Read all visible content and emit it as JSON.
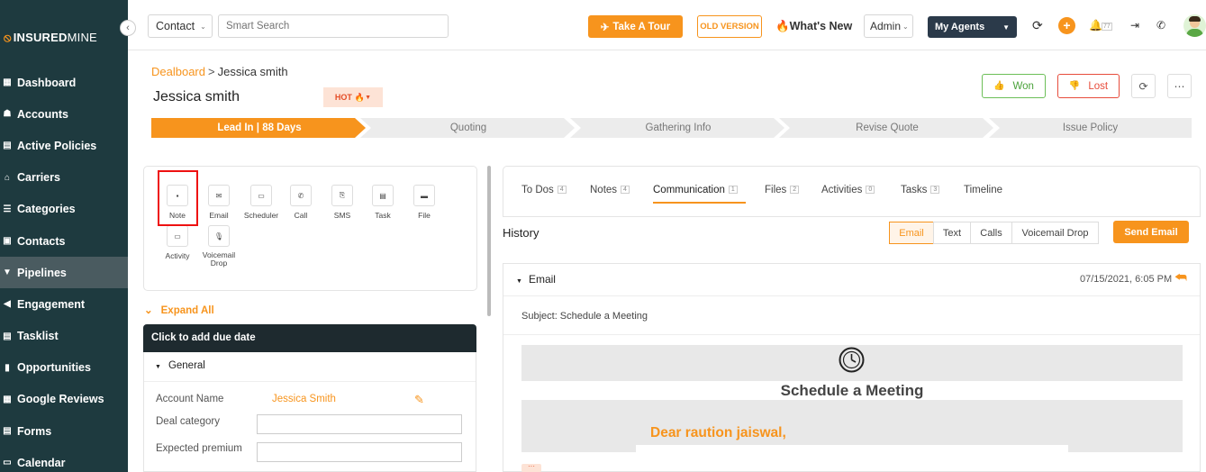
{
  "brand": {
    "mark": "⦸",
    "part1": "INSURED",
    "part2": "MINE"
  },
  "sidebar": {
    "items": [
      {
        "label": "Dashboard",
        "icon": "grid-icon"
      },
      {
        "label": "Accounts",
        "icon": "users-icon"
      },
      {
        "label": "Active Policies",
        "icon": "policy-icon"
      },
      {
        "label": "Carriers",
        "icon": "bank-icon"
      },
      {
        "label": "Categories",
        "icon": "list-icon"
      },
      {
        "label": "Contacts",
        "icon": "contact-icon"
      },
      {
        "label": "Pipelines",
        "icon": "funnel-icon"
      },
      {
        "label": "Engagement",
        "icon": "megaphone-icon"
      },
      {
        "label": "Tasklist",
        "icon": "task-icon"
      },
      {
        "label": "Opportunities",
        "icon": "bars-icon"
      },
      {
        "label": "Google Reviews",
        "icon": "review-icon"
      },
      {
        "label": "Forms",
        "icon": "form-icon"
      },
      {
        "label": "Calendar",
        "icon": "calendar-icon"
      }
    ]
  },
  "topbar": {
    "contact_select": "Contact",
    "search_placeholder": "Smart Search",
    "tour_label": "Take A Tour",
    "old_version_label": "OLD VERSION",
    "whats_new_label": "What's New",
    "admin_select": "Admin",
    "my_agents_select": "My Agents",
    "notification_count": "77"
  },
  "header": {
    "breadcrumb_link": "Dealboard",
    "breadcrumb_sep": ">",
    "breadcrumb_current": "Jessica smith",
    "title": "Jessica smith",
    "temperature_label": "HOT",
    "won_label": "Won",
    "lost_label": "Lost"
  },
  "stages": [
    {
      "label": "Lead In | 88 Days",
      "active": true
    },
    {
      "label": "Quoting",
      "active": false
    },
    {
      "label": "Gathering Info",
      "active": false
    },
    {
      "label": "Revise Quote",
      "active": false
    },
    {
      "label": "Issue Policy",
      "active": false
    }
  ],
  "actions": {
    "note": "Note",
    "email": "Email",
    "scheduler": "Scheduler",
    "call": "Call",
    "sms": "SMS",
    "task": "Task",
    "file": "File",
    "activity": "Activity",
    "voicemail": "Voicemail Drop"
  },
  "details": {
    "expand_all": "Expand All",
    "due_date_prompt": "Click to add due date",
    "general_label": "General",
    "account_name_label": "Account Name",
    "account_name_value": "Jessica Smith",
    "deal_category_label": "Deal category",
    "expected_premium_label": "Expected premium"
  },
  "tabs": [
    {
      "label": "To Dos",
      "count": "4"
    },
    {
      "label": "Notes",
      "count": "4"
    },
    {
      "label": "Communication",
      "count": "1"
    },
    {
      "label": "Files",
      "count": "2"
    },
    {
      "label": "Activities",
      "count": "0"
    },
    {
      "label": "Tasks",
      "count": "3"
    },
    {
      "label": "Timeline",
      "count": ""
    }
  ],
  "history": {
    "title": "History",
    "filters": [
      "Email",
      "Text",
      "Calls",
      "Voicemail Drop"
    ],
    "send_email_label": "Send Email"
  },
  "email": {
    "type_label": "Email",
    "date": "07/15/2021, 6:05 PM",
    "subject": "Subject: Schedule a Meeting",
    "heading": "Schedule a Meeting",
    "greeting": "Dear raution jaiswal,"
  },
  "colors": {
    "accent": "#f7941d",
    "sidebar_bg": "#1e3a3f",
    "won": "#4aa23a",
    "lost": "#e74c3c"
  }
}
